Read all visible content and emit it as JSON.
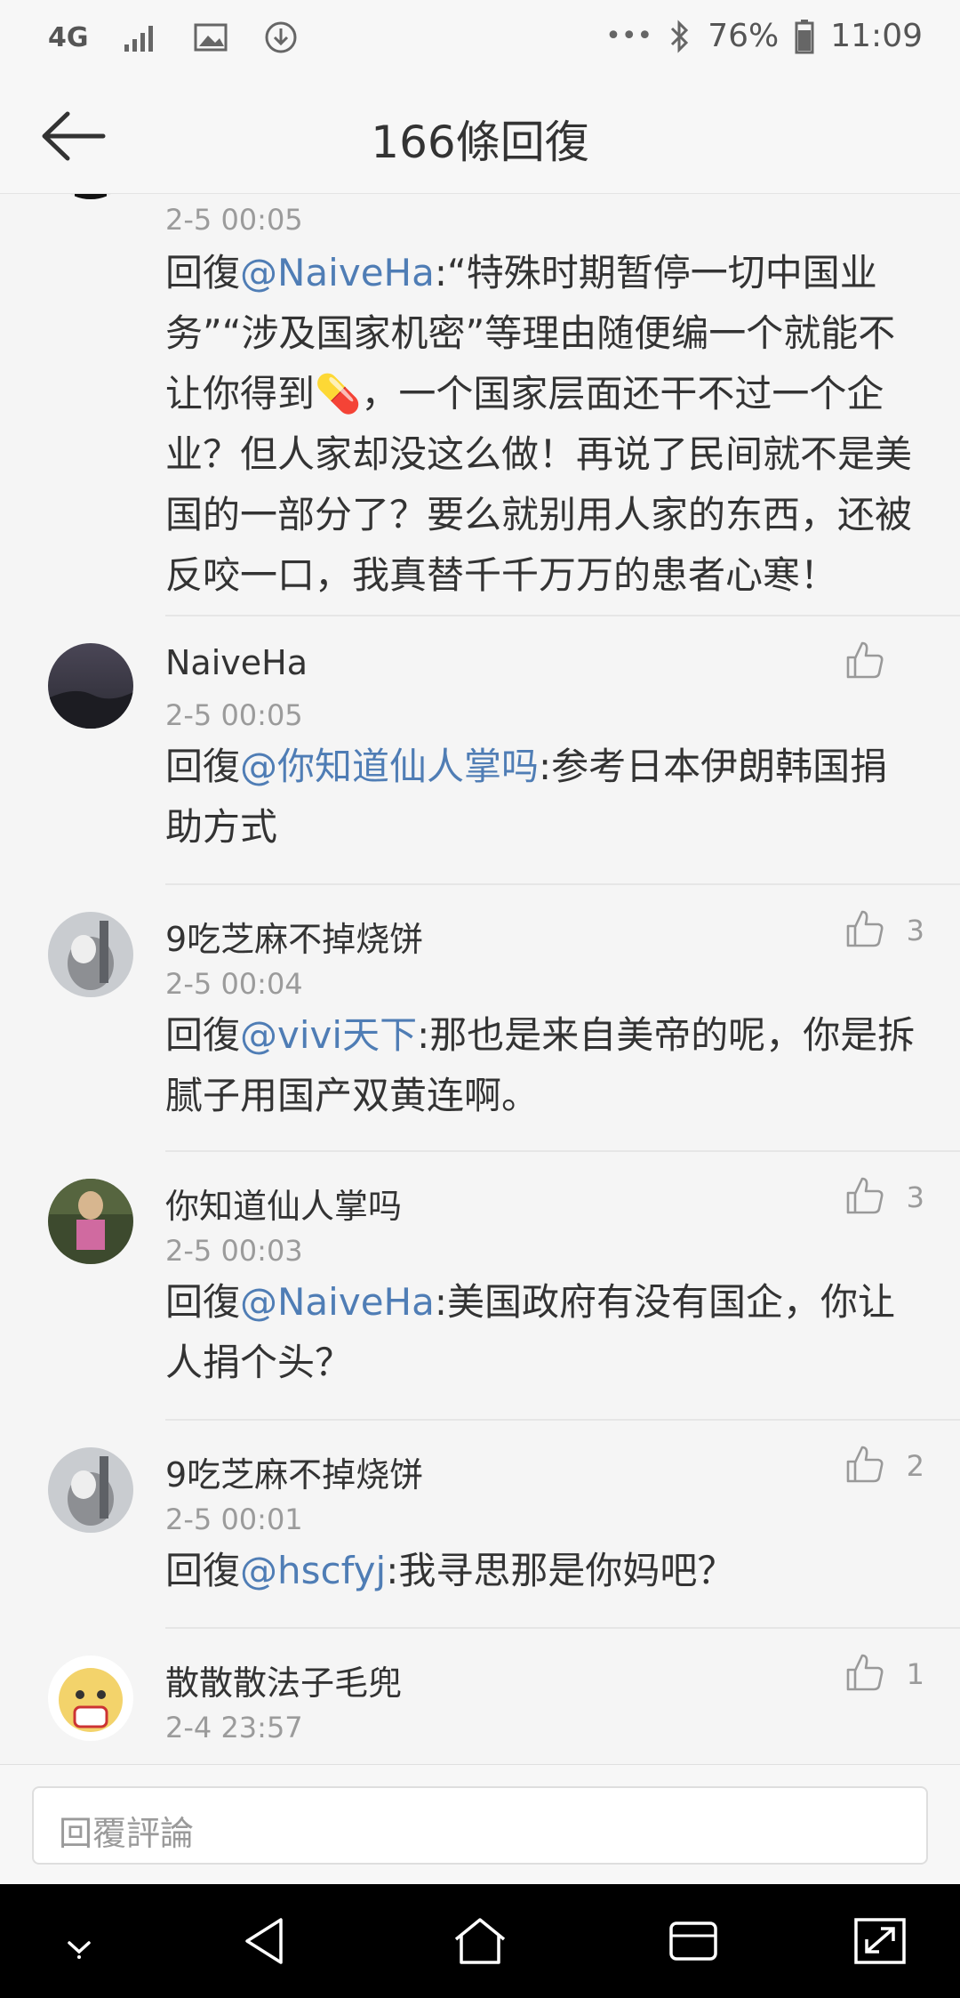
{
  "status_bar": {
    "network": "4G",
    "battery": "76%",
    "time": "11:09",
    "icons": [
      "signal-icon",
      "gallery-icon",
      "download-icon",
      "more-dots-icon",
      "bluetooth-icon",
      "battery-icon"
    ]
  },
  "header": {
    "title": "166條回復",
    "back_icon": "back-arrow-icon"
  },
  "comments": [
    {
      "time": "2-5 00:05",
      "prefix": "回復",
      "mention": "@NaiveHa",
      "text_before_emoji": ":“特殊时期暂停一切中国业务”“涉及国家机密”等理由随便编一个就能不让你得到",
      "emoji": "💊",
      "text_after_emoji": "，一个国家层面还干不过一个企业？但人家却没这么做！再说了民间就不是美国的一部分了？要么就别用人家的东西，还被反咬一口，我真替千千万万的患者心寒！"
    },
    {
      "name": "NaiveHa",
      "time": "2-5 00:05",
      "likes": "",
      "prefix": "回復",
      "mention": "@你知道仙人掌吗",
      "text": ":参考日本伊朗韩国捐助方式"
    },
    {
      "name": "9吃芝麻不掉烧饼",
      "time": "2-5 00:04",
      "likes": "3",
      "prefix": "回復",
      "mention": "@vivi天下",
      "text": ":那也是来自美帝的呢，你是拆腻子用国产双黄连啊。"
    },
    {
      "name": "你知道仙人掌吗",
      "time": "2-5 00:03",
      "likes": "3",
      "prefix": "回復",
      "mention": "@NaiveHa",
      "text": ":美国政府有没有国企，你让人捐个头？"
    },
    {
      "name": "9吃芝麻不掉烧饼",
      "time": "2-5 00:01",
      "likes": "2",
      "prefix": "回復",
      "mention": "@hscfyj",
      "text": ":我寻思那是你妈吧？"
    },
    {
      "name": "散散散法子毛兜",
      "time": "2-4 23:57",
      "likes": "1"
    }
  ],
  "reply_input": {
    "placeholder": "回覆評論"
  },
  "colors": {
    "mention": "#4f7db5",
    "meta": "#9b9b9b",
    "background": "#f5f5f5"
  }
}
